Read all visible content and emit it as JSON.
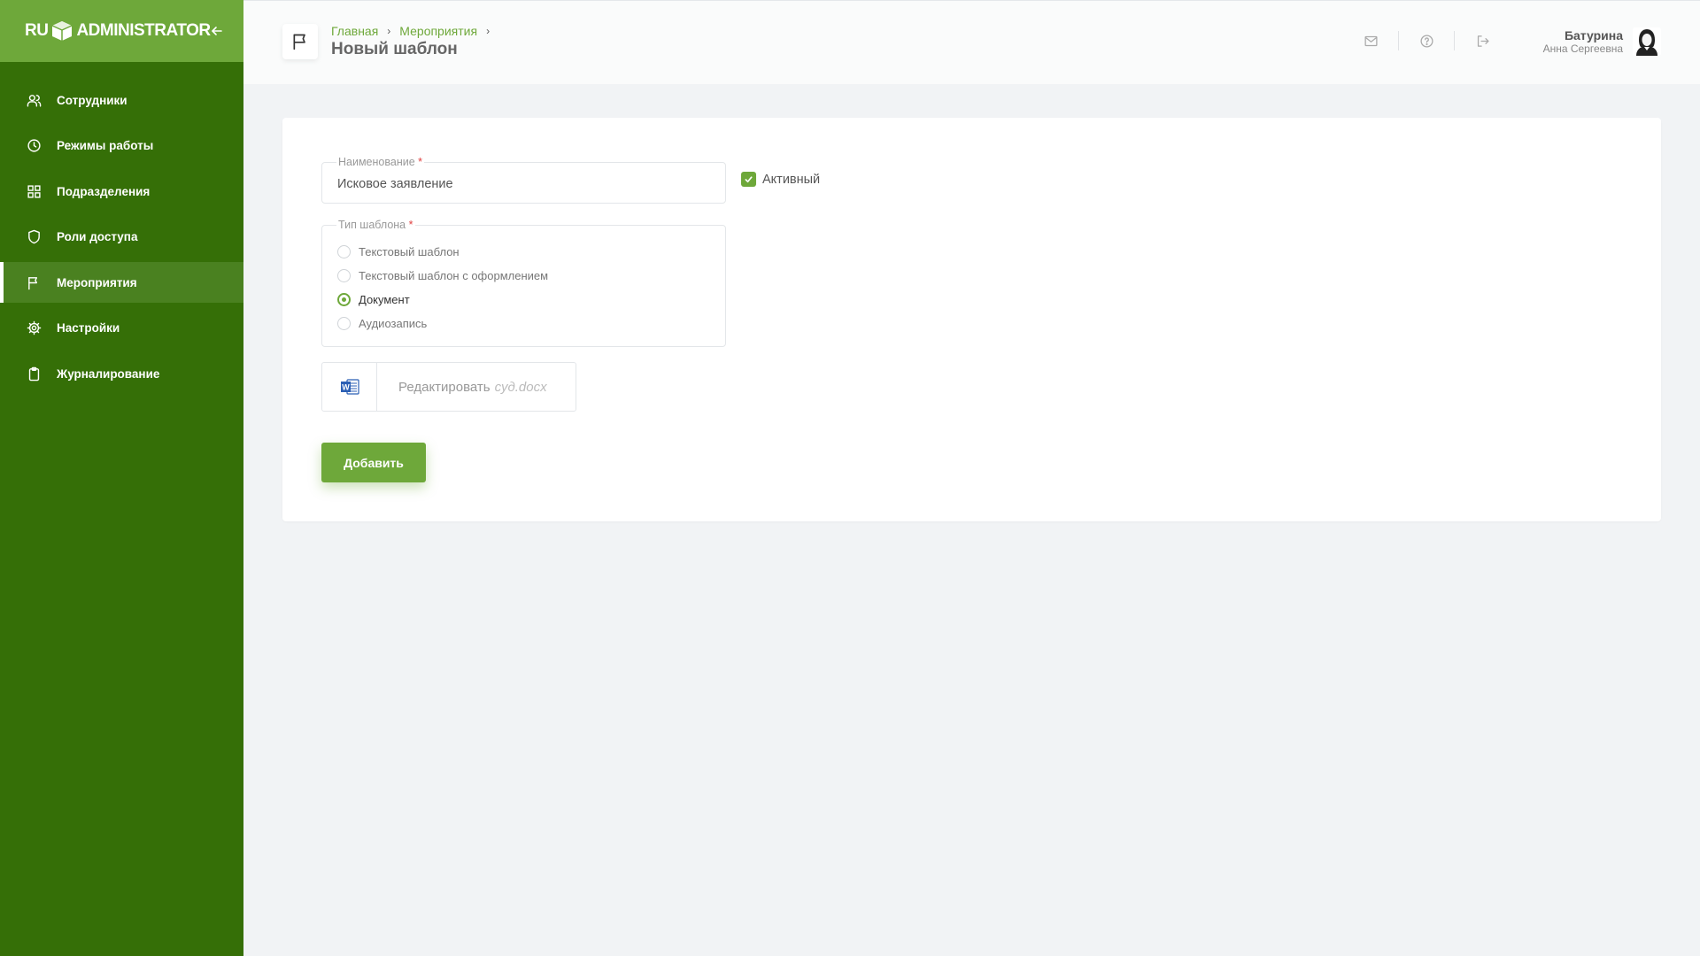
{
  "brand": {
    "left": "RU",
    "right": "ADMINISTRATOR"
  },
  "sidebar": {
    "items": [
      {
        "label": "Сотрудники",
        "icon": "users-icon"
      },
      {
        "label": "Режимы работы",
        "icon": "clock-icon"
      },
      {
        "label": "Подразделения",
        "icon": "grid-icon"
      },
      {
        "label": "Роли доступа",
        "icon": "shield-icon"
      },
      {
        "label": "Мероприятия",
        "icon": "flag-icon",
        "active": true
      },
      {
        "label": "Настройки",
        "icon": "gear-icon"
      },
      {
        "label": "Журналирование",
        "icon": "clipboard-icon"
      }
    ]
  },
  "header": {
    "breadcrumbs": [
      "Главная",
      "Мероприятия"
    ],
    "title": "Новый шаблон",
    "user": {
      "name": "Батурина",
      "subtitle": "Анна Сергеевна"
    }
  },
  "form": {
    "name": {
      "label": "Наименование",
      "required": "*",
      "value": "Исковое заявление"
    },
    "active": {
      "label": "Активный",
      "checked": true
    },
    "template_type": {
      "label": "Тип шаблона",
      "required": "*",
      "options": [
        "Текстовый шаблон",
        "Текстовый шаблон с оформлением",
        "Документ",
        "Аудиозапись"
      ],
      "selected": "Документ"
    },
    "file": {
      "action": "Редактировать",
      "filename": "суд.docx"
    },
    "submit_label": "Добавить"
  },
  "colors": {
    "sidebar": "#356f07",
    "accent": "#6ea83a",
    "active_item": "#4a8120"
  }
}
